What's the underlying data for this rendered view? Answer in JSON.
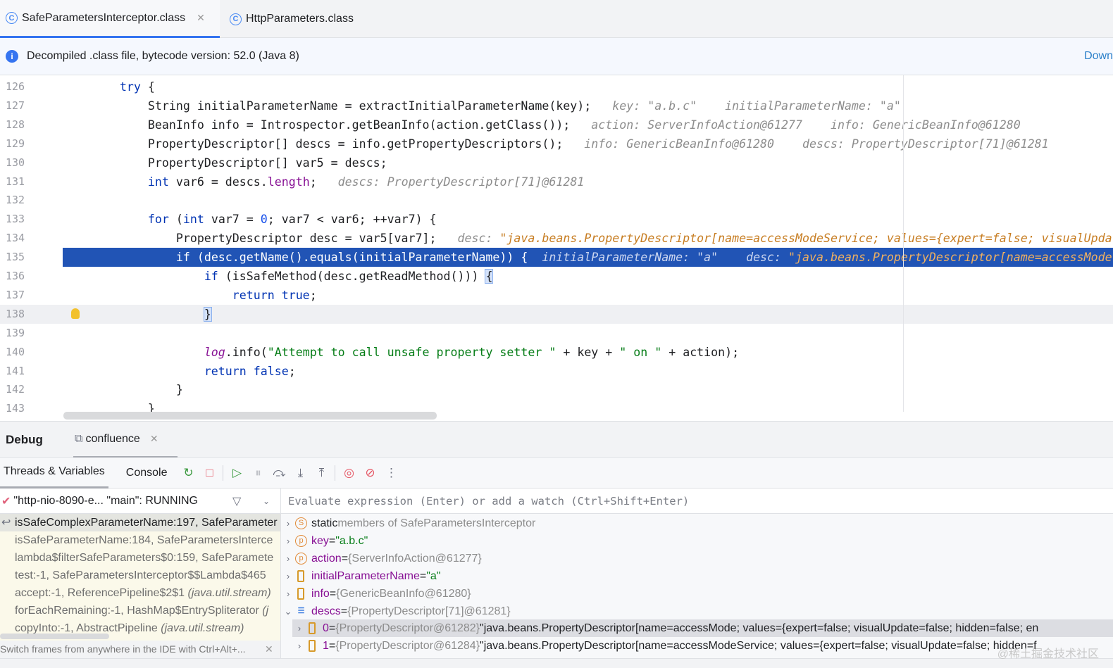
{
  "tabs": [
    {
      "label": "SafeParametersInterceptor.class",
      "active": true
    },
    {
      "label": "HttpParameters.class",
      "active": false
    }
  ],
  "info": {
    "text": "Decompiled .class file, bytecode version: 52.0 (Java 8)",
    "action": "Down"
  },
  "code": [
    {
      "n": "126",
      "seg": [
        [
          "p",
          "        "
        ],
        [
          "k",
          "try"
        ],
        [
          "p",
          " {"
        ]
      ]
    },
    {
      "n": "127",
      "seg": [
        [
          "p",
          "            String initialParameterName = extractInitialParameterName(key);   "
        ],
        [
          "i",
          "key: \"a.b.c\"    initialParameterName: \"a\""
        ]
      ]
    },
    {
      "n": "128",
      "seg": [
        [
          "p",
          "            BeanInfo info = Introspector.getBeanInfo(action.getClass());   "
        ],
        [
          "i",
          "action: ServerInfoAction@61277    info: GenericBeanInfo@61280"
        ]
      ]
    },
    {
      "n": "129",
      "seg": [
        [
          "p",
          "            PropertyDescriptor[] descs = info.getPropertyDescriptors();   "
        ],
        [
          "i",
          "info: GenericBeanInfo@61280    descs: PropertyDescriptor[71]@61281"
        ]
      ]
    },
    {
      "n": "130",
      "seg": [
        [
          "p",
          "            PropertyDescriptor[] var5 = descs;"
        ]
      ]
    },
    {
      "n": "131",
      "seg": [
        [
          "p",
          "            "
        ],
        [
          "k",
          "int"
        ],
        [
          "p",
          " var6 = descs."
        ],
        [
          "f",
          "length"
        ],
        [
          "p",
          ";   "
        ],
        [
          "i",
          "descs: PropertyDescriptor[71]@61281"
        ]
      ]
    },
    {
      "n": "132",
      "seg": []
    },
    {
      "n": "133",
      "seg": [
        [
          "p",
          "            "
        ],
        [
          "k",
          "for"
        ],
        [
          "p",
          " ("
        ],
        [
          "k",
          "int"
        ],
        [
          "p",
          " var7 = "
        ],
        [
          "n",
          "0"
        ],
        [
          "p",
          "; var7 < var6; ++var7) {"
        ]
      ]
    },
    {
      "n": "134",
      "seg": [
        [
          "p",
          "                PropertyDescriptor desc = var5[var7];   "
        ],
        [
          "i",
          "desc: "
        ],
        [
          "is",
          "\"java.beans.PropertyDescriptor[name=accessModeService; values={expert=false; visualUpdate"
        ]
      ]
    },
    {
      "n": "135",
      "hl": true,
      "seg": [
        [
          "p",
          "                "
        ],
        [
          "k",
          "if"
        ],
        [
          "p",
          " (desc.getName().equals(initialParameterName)) {  "
        ],
        [
          "i",
          "initialParameterName: \"a\"    desc: "
        ],
        [
          "is",
          "\"java.beans.PropertyDescriptor[name=accessMode"
        ]
      ]
    },
    {
      "n": "136",
      "seg": [
        [
          "p",
          "                    "
        ],
        [
          "k",
          "if"
        ],
        [
          "p",
          " (isSafeMethod(desc.getReadMethod())) "
        ],
        [
          "b",
          "{"
        ]
      ]
    },
    {
      "n": "137",
      "seg": [
        [
          "p",
          "                        "
        ],
        [
          "k",
          "return true"
        ],
        [
          "p",
          ";"
        ]
      ]
    },
    {
      "n": "138",
      "caret": true,
      "seg": [
        [
          "p",
          "                    "
        ],
        [
          "b",
          "}"
        ]
      ]
    },
    {
      "n": "139",
      "seg": []
    },
    {
      "n": "140",
      "seg": [
        [
          "p",
          "                    "
        ],
        [
          "lg",
          "log"
        ],
        [
          "p",
          ".info("
        ],
        [
          "s",
          "\"Attempt to call unsafe property setter \""
        ],
        [
          "p",
          " + key + "
        ],
        [
          "s",
          "\" on \""
        ],
        [
          "p",
          " + action);"
        ]
      ]
    },
    {
      "n": "141",
      "seg": [
        [
          "p",
          "                    "
        ],
        [
          "k",
          "return false"
        ],
        [
          "p",
          ";"
        ]
      ]
    },
    {
      "n": "142",
      "seg": [
        [
          "p",
          "                }"
        ]
      ]
    },
    {
      "n": "143",
      "seg": [
        [
          "p",
          "            }"
        ]
      ]
    }
  ],
  "debug": {
    "title": "Debug",
    "session": "confluence",
    "tabs": [
      "Threads & Variables",
      "Console"
    ]
  },
  "thread": {
    "label": "\"http-nio-8090-e... \"main\": RUNNING"
  },
  "frames": [
    {
      "name": "isSafeComplexParameterName:197, SafeParameter",
      "pkg": ""
    },
    {
      "name": "isSafeParameterName:184, SafeParametersInterce",
      "pkg": ""
    },
    {
      "name": "lambda$filterSafeParameters$0:159, SafeParamete",
      "pkg": ""
    },
    {
      "name": "test:-1, SafeParametersInterceptor$$Lambda$465",
      "pkg": ""
    },
    {
      "name": "accept:-1, ReferencePipeline$2$1 ",
      "pkg": "(java.util.stream)"
    },
    {
      "name": "forEachRemaining:-1, HashMap$EntrySpliterator ",
      "pkg": "(j"
    },
    {
      "name": "copyInto:-1, AbstractPipeline ",
      "pkg": "(java.util.stream)"
    }
  ],
  "frames_hint": "Switch frames from anywhere in the IDE with Ctrl+Alt+...",
  "eval_placeholder": "Evaluate expression (Enter) or add a watch (Ctrl+Shift+Enter)",
  "variables": [
    {
      "icon": "S",
      "name": "static",
      "rest": " members of SafeParametersInterceptor",
      "value": "",
      "kind": "static"
    },
    {
      "icon": "p",
      "name": "key",
      "rest": " = ",
      "value": "\"a.b.c\"",
      "kind": "str"
    },
    {
      "icon": "p",
      "name": "action",
      "rest": " = ",
      "value": "{ServerInfoAction@61277}",
      "kind": "obj"
    },
    {
      "icon": "f",
      "name": "initialParameterName",
      "rest": " = ",
      "value": "\"a\"",
      "kind": "str"
    },
    {
      "icon": "f",
      "name": "info",
      "rest": " = ",
      "value": "{GenericBeanInfo@61280}",
      "kind": "obj"
    },
    {
      "icon": "a",
      "name": "descs",
      "rest": " = ",
      "value": "{PropertyDescriptor[71]@61281}",
      "kind": "obj",
      "expanded": true
    },
    {
      "icon": "f",
      "name": "0",
      "rest": " = ",
      "value": "{PropertyDescriptor@61282}",
      "extra": " \"java.beans.PropertyDescriptor[name=accessMode; values={expert=false; visualUpdate=false; hidden=false; en",
      "kind": "obj",
      "child": true,
      "selected": true
    },
    {
      "icon": "f",
      "name": "1",
      "rest": " = ",
      "value": "{PropertyDescriptor@61284}",
      "extra": " \"java.beans.PropertyDescriptor[name=accessModeService; values={expert=false; visualUpdate=false; hidden=f",
      "kind": "obj",
      "child": true
    }
  ],
  "watermark": "@稀土掘金技术社区"
}
